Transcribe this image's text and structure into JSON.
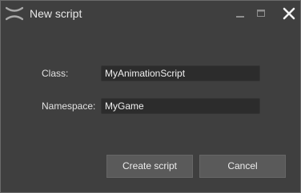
{
  "window": {
    "title": "New script",
    "icons": {
      "logo": "app-logo-icon",
      "minimize": "minimize-icon",
      "maximize": "maximize-icon",
      "close": "close-icon"
    }
  },
  "form": {
    "class_label": "Class:",
    "class_value": "MyAnimationScript",
    "namespace_label": "Namespace:",
    "namespace_value": "MyGame"
  },
  "buttons": {
    "create_label": "Create script",
    "cancel_label": "Cancel"
  },
  "colors": {
    "background": "#3f3f3f",
    "input_background": "#2c2c2c",
    "button_background": "#5a5a5a",
    "text": "#e6e6e6"
  }
}
